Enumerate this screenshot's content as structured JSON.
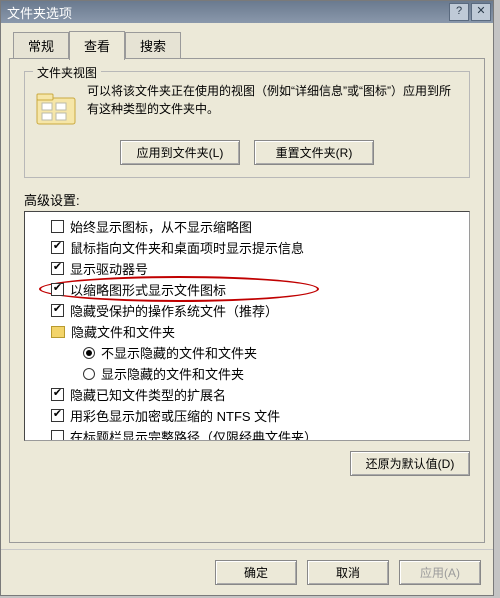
{
  "title": "文件夹选项",
  "tabs": {
    "general": "常规",
    "view": "查看",
    "search": "搜索"
  },
  "viewGroup": {
    "label": "文件夹视图",
    "desc": "可以将该文件夹正在使用的视图（例如“详细信息”或“图标”）应用到所有这种类型的文件夹中。",
    "applyBtn": "应用到文件夹(L)",
    "resetBtn": "重置文件夹(R)"
  },
  "advLabel": "高级设置:",
  "items": [
    {
      "type": "chk",
      "checked": false,
      "label": "始终显示图标，从不显示缩略图"
    },
    {
      "type": "chk",
      "checked": true,
      "label": "鼠标指向文件夹和桌面项时显示提示信息"
    },
    {
      "type": "chk",
      "checked": true,
      "label": "显示驱动器号"
    },
    {
      "type": "chk",
      "checked": true,
      "label": "以缩略图形式显示文件图标"
    },
    {
      "type": "chk",
      "checked": true,
      "label": "隐藏受保护的操作系统文件（推荐）"
    },
    {
      "type": "folder",
      "label": "隐藏文件和文件夹"
    },
    {
      "type": "rad",
      "sub": true,
      "checked": true,
      "label": "不显示隐藏的文件和文件夹"
    },
    {
      "type": "rad",
      "sub": true,
      "checked": false,
      "label": "显示隐藏的文件和文件夹"
    },
    {
      "type": "chk",
      "checked": true,
      "label": "隐藏已知文件类型的扩展名"
    },
    {
      "type": "chk",
      "checked": true,
      "label": "用彩色显示加密或压缩的 NTFS 文件"
    },
    {
      "type": "chk",
      "checked": false,
      "label": "在标题栏显示完整路径（仅限经典文件夹）"
    }
  ],
  "restoreBtn": "还原为默认值(D)",
  "btns": {
    "ok": "确定",
    "cancel": "取消",
    "apply": "应用(A)"
  },
  "closeHelp": {
    "help": "?",
    "close": "✕"
  }
}
